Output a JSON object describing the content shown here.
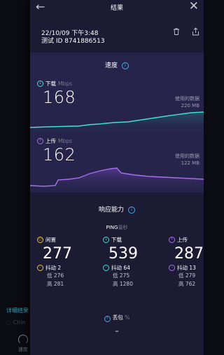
{
  "background": {
    "detail_link": "详细结果",
    "wifi_label": "Chin",
    "tab_label": "速度"
  },
  "header": {
    "title": "结果"
  },
  "meta": {
    "timestamp": "22/10/09 下午3:48",
    "test_id": "测试 ID 8741886513"
  },
  "speed": {
    "section_title": "速度",
    "download": {
      "label": "下载",
      "unit": "Mbps",
      "value": "168",
      "data_used_label": "使用的数据",
      "data_used_value": "220 MB",
      "color": "#3ee0d0"
    },
    "upload": {
      "label": "上传",
      "unit": "Mbps",
      "value": "162",
      "data_used_label": "使用的数据",
      "data_used_value": "122 MB",
      "color": "#a86ef0"
    }
  },
  "response": {
    "section_title": "响应能力",
    "ping_label": "PING",
    "ping_unit": "毫秒",
    "idle": {
      "label": "闲置",
      "value": "277",
      "jitter": "抖动 2",
      "low": "低 276",
      "high": "高 281",
      "color": "#e8c64a"
    },
    "down": {
      "label": "下载",
      "value": "539",
      "jitter": "抖动 64",
      "low": "低 275",
      "high": "高 1280",
      "color": "#3ee0d0"
    },
    "up": {
      "label": "上传",
      "value": "287",
      "jitter": "抖动 13",
      "low": "低 279",
      "high": "高 762",
      "color": "#a86ef0"
    }
  },
  "packet_loss": {
    "label": "丢包",
    "unit": "%",
    "value": "–"
  }
}
